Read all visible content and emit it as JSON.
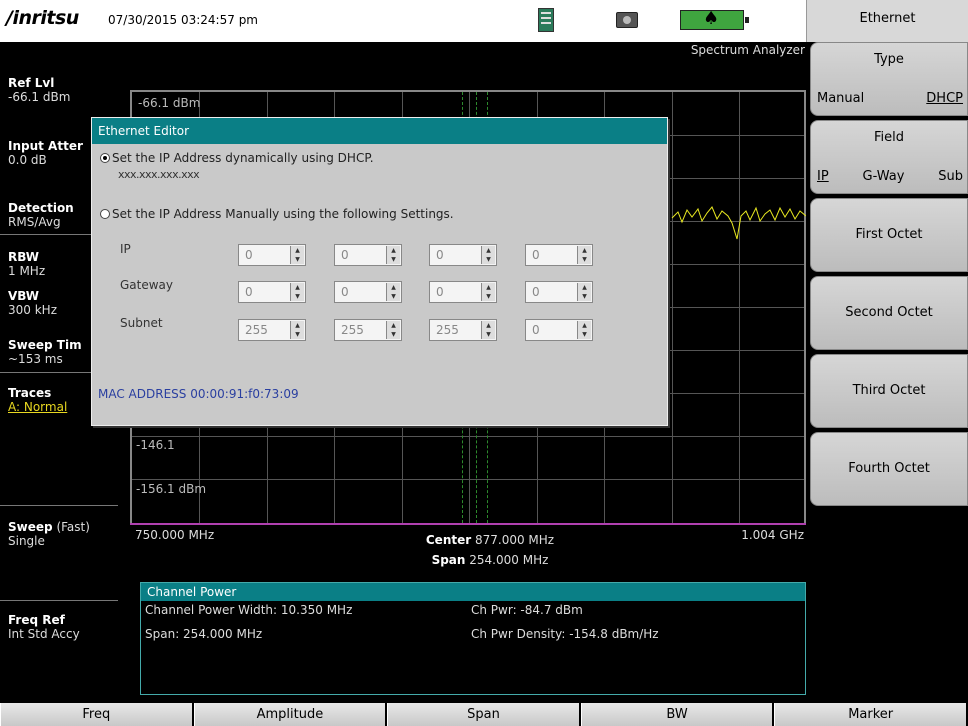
{
  "header": {
    "brand": "/inritsu",
    "datetime": "07/30/2015 03:24:57 pm",
    "mode": "Spectrum Analyzer"
  },
  "left_panel": {
    "ref_lvl_label": "Ref Lvl",
    "ref_lvl_value": "-66.1 dBm",
    "input_atten_label": "Input Atter",
    "input_atten_value": "0.0 dB",
    "detection_label": "Detection",
    "detection_value": "RMS/Avg",
    "rbw_label": "RBW",
    "rbw_value": "1 MHz",
    "vbw_label": "VBW",
    "vbw_value": "300 kHz",
    "sweep_time_label": "Sweep Tim",
    "sweep_time_value": "~153 ms",
    "traces_label": "Traces",
    "traces_value": "A: Normal",
    "sweep_label": "Sweep",
    "sweep_fast": "(Fast)",
    "sweep_value": "Single",
    "freq_ref_label": "Freq Ref",
    "freq_ref_value": "Int Std Accy"
  },
  "graph": {
    "top_label": "-66.1 dBm",
    "label_146": "-146.1",
    "label_156": "-156.1 dBm",
    "start_freq": "750.000 MHz",
    "center_label": "Center",
    "center_value": "877.000 MHz",
    "span_label": "Span",
    "span_value": "254.000 MHz",
    "stop_freq": "1.004 GHz",
    "trace_color": "#e8e820"
  },
  "channel_power": {
    "title": "Channel Power",
    "width": "Channel Power Width: 10.350 MHz",
    "span": "Span: 254.000 MHz",
    "ch_pwr": "Ch Pwr: -84.7 dBm",
    "density": "Ch Pwr Density: -154.8 dBm/Hz"
  },
  "menu": {
    "title": "Ethernet",
    "type_label": "Type",
    "type_manual": "Manual",
    "type_dhcp": "DHCP",
    "field_label": "Field",
    "field_ip": "IP",
    "field_gway": "G-Way",
    "field_sub": "Sub",
    "first_octet": "First Octet",
    "second_octet": "Second Octet",
    "third_octet": "Third Octet",
    "fourth_octet": "Fourth Octet"
  },
  "bottom_menu": {
    "freq": "Freq",
    "amplitude": "Amplitude",
    "span": "Span",
    "bw": "BW",
    "marker": "Marker"
  },
  "dialog": {
    "title": "Ethernet Editor",
    "dhcp_option": "Set the IP Address dynamically using DHCP.",
    "dhcp_masked": "xxx.xxx.xxx.xxx",
    "manual_option": "Set the IP Address Manually using the following Settings.",
    "ip_label": "IP",
    "gateway_label": "Gateway",
    "subnet_label": "Subnet",
    "ip": [
      "0",
      "0",
      "0",
      "0"
    ],
    "gateway": [
      "0",
      "0",
      "0",
      "0"
    ],
    "subnet": [
      "255",
      "255",
      "255",
      "0"
    ],
    "mac": "MAC ADDRESS 00:00:91:f0:73:09"
  }
}
